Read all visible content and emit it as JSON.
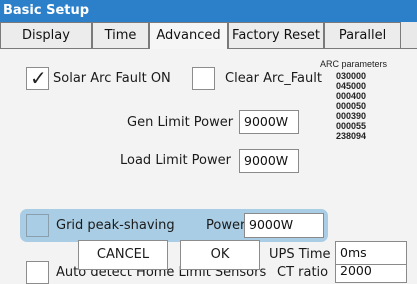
{
  "window": {
    "title": "Basic Setup"
  },
  "tabs": [
    {
      "label": "Display",
      "active": false
    },
    {
      "label": "Time",
      "active": false
    },
    {
      "label": "Advanced",
      "active": true
    },
    {
      "label": "Factory Reset",
      "active": false
    },
    {
      "label": "Parallel",
      "active": false
    }
  ],
  "advanced": {
    "solar_arc_fault": {
      "label": "Solar Arc Fault ON",
      "checked": true
    },
    "clear_arc_fault": {
      "label": "Clear Arc_Fault",
      "checked": false
    },
    "arc_parameters": {
      "title": "ARC parameters",
      "values": [
        "030000",
        "045000",
        "000400",
        "000050",
        "000390",
        "000055",
        "238094"
      ]
    },
    "gen_limit_power": {
      "label": "Gen Limit Power",
      "value": "9000W"
    },
    "load_limit_power": {
      "label": "Load Limit Power",
      "value": "9000W"
    },
    "grid_peak_shaving": {
      "label": "Grid peak-shaving",
      "checked": false,
      "power_label": "Power",
      "power_value": "9000W"
    },
    "auto_detect": {
      "label": "Auto detect Home Limit Sensors",
      "checked": false
    },
    "ct_ratio": {
      "label": "CT ratio",
      "value": "2000"
    },
    "ups_time": {
      "label": "UPS Time",
      "value": "0ms"
    },
    "cancel_label": "CANCEL",
    "ok_label": "OK"
  },
  "colors": {
    "title_bar": "#2b80c9",
    "highlight": "#a9cde4"
  }
}
